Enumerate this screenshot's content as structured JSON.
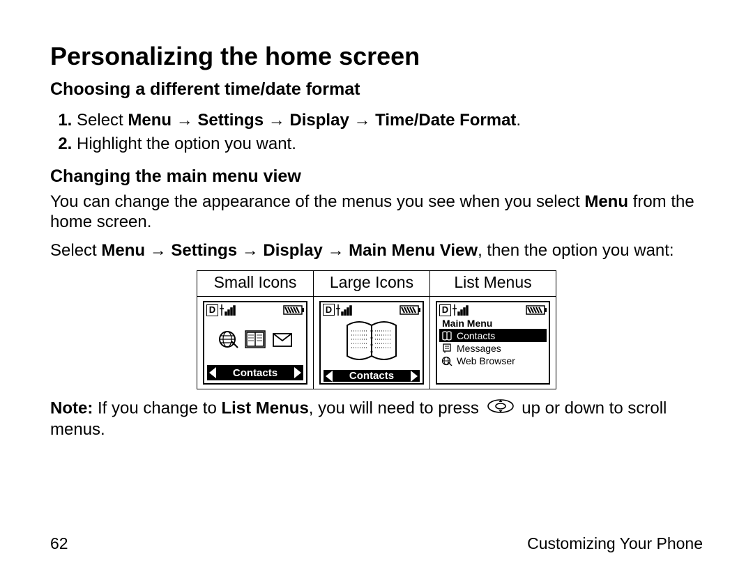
{
  "heading": "Personalizing the home screen",
  "subheading_a": "Choosing a different time/date format",
  "step1_prefix": "Select ",
  "step1_menu": "Menu",
  "step1_settings": "Settings",
  "step1_display": "Display",
  "step1_tdf": "Time/Date Format",
  "arrow": "→",
  "step2": "Highlight the option you want.",
  "subheading_b": "Changing the main menu view",
  "para_b_part1": "You can change the appearance of the menus you see when you select ",
  "para_b_bold": "Menu",
  "para_b_part2": " from the home screen.",
  "para_c_prefix": "Select ",
  "para_c_menu": "Menu",
  "para_c_settings": "Settings",
  "para_c_display": "Display",
  "para_c_mmv": "Main Menu View",
  "para_c_suffix": ", then the option you want:",
  "table": {
    "col1": "Small Icons",
    "col2": "Large Icons",
    "col3": "List Menus",
    "small_footer": "Contacts",
    "large_footer": "Contacts",
    "list_title": "Main Menu",
    "list_items": [
      {
        "label": "Contacts",
        "selected": true
      },
      {
        "label": "Messages",
        "selected": false
      },
      {
        "label": "Web Browser",
        "selected": false
      }
    ],
    "status_d": "D"
  },
  "note_prefix": "Note:",
  "note_mid1": " If you change to ",
  "note_bold": "List Menus",
  "note_mid2": ", you will need to press ",
  "note_suffix": " up or down to scroll menus.",
  "page_number": "62",
  "section_title": "Customizing Your Phone"
}
